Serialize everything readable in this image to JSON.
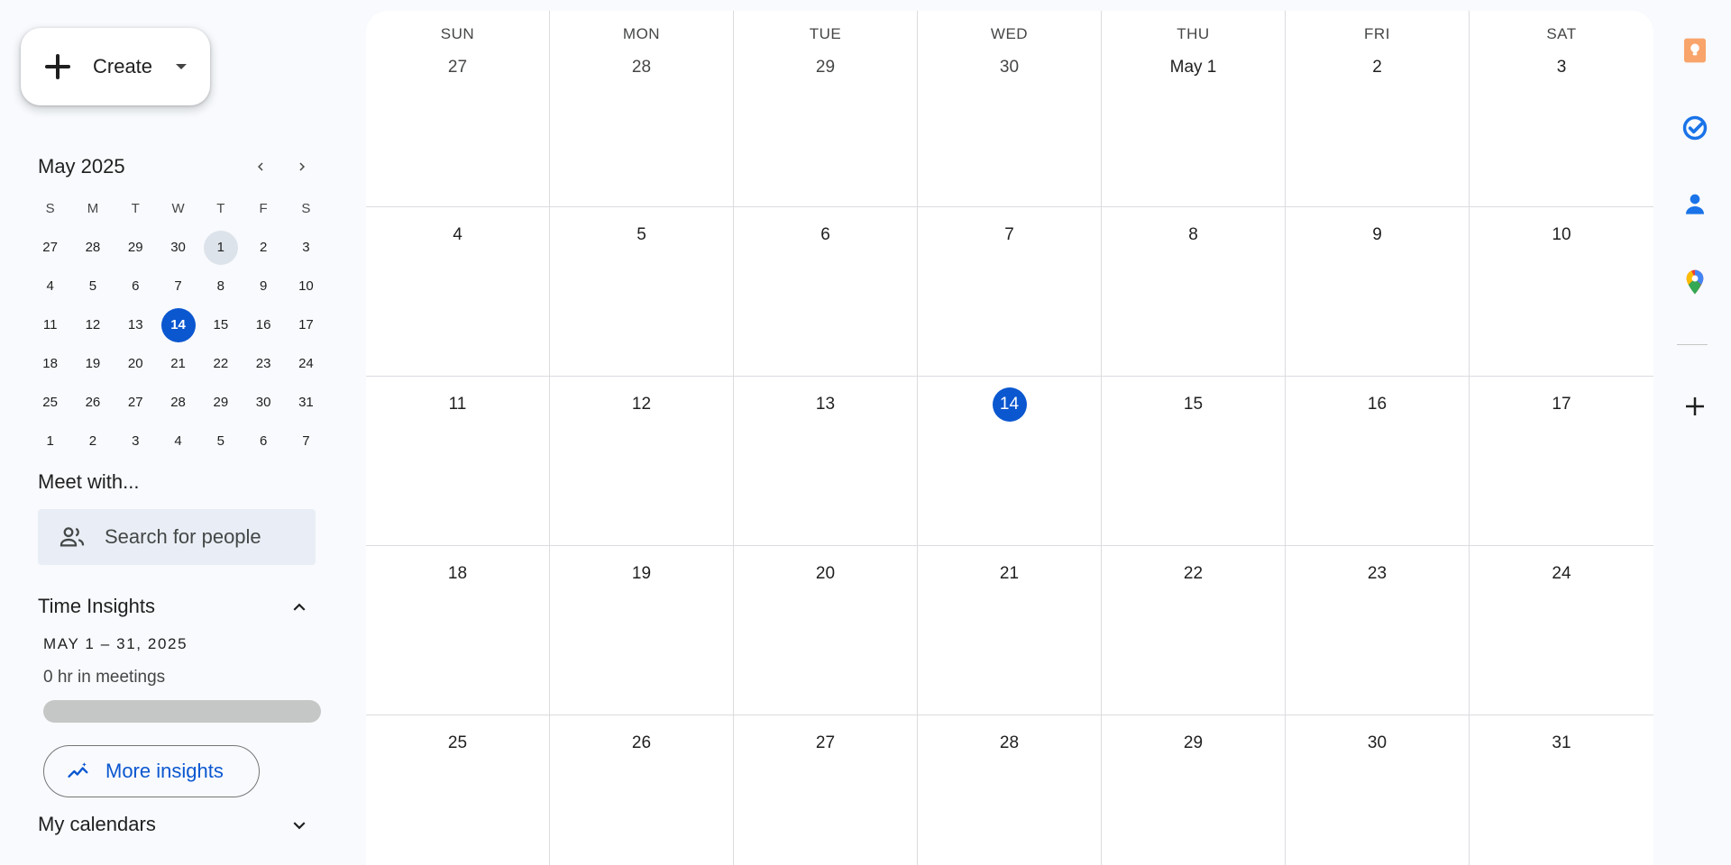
{
  "sidebar": {
    "create_label": "Create",
    "mini_calendar": {
      "title": "May 2025",
      "weekday_headers": [
        "S",
        "M",
        "T",
        "W",
        "T",
        "F",
        "S"
      ],
      "weeks": [
        [
          "27",
          "28",
          "29",
          "30",
          "1",
          "2",
          "3"
        ],
        [
          "4",
          "5",
          "6",
          "7",
          "8",
          "9",
          "10"
        ],
        [
          "11",
          "12",
          "13",
          "14",
          "15",
          "16",
          "17"
        ],
        [
          "18",
          "19",
          "20",
          "21",
          "22",
          "23",
          "24"
        ],
        [
          "25",
          "26",
          "27",
          "28",
          "29",
          "30",
          "31"
        ],
        [
          "1",
          "2",
          "3",
          "4",
          "5",
          "6",
          "7"
        ]
      ],
      "today": "14",
      "selected": "1"
    },
    "meet_with": {
      "title": "Meet with...",
      "search_placeholder": "Search for people"
    },
    "time_insights": {
      "title": "Time Insights",
      "range": "MAY 1 – 31, 2025",
      "hours": "0 hr in meetings",
      "meeting_fraction": 0,
      "more_label": "More insights"
    },
    "my_calendars": {
      "title": "My calendars"
    }
  },
  "month_view": {
    "weekdays": [
      "SUN",
      "MON",
      "TUE",
      "WED",
      "THU",
      "FRI",
      "SAT"
    ],
    "weeks": [
      [
        "27",
        "28",
        "29",
        "30",
        "May 1",
        "2",
        "3"
      ],
      [
        "4",
        "5",
        "6",
        "7",
        "8",
        "9",
        "10"
      ],
      [
        "11",
        "12",
        "13",
        "14",
        "15",
        "16",
        "17"
      ],
      [
        "18",
        "19",
        "20",
        "21",
        "22",
        "23",
        "24"
      ],
      [
        "25",
        "26",
        "27",
        "28",
        "29",
        "30",
        "31"
      ]
    ],
    "today": "14"
  },
  "side_panel": {
    "icons": [
      "keep-icon",
      "tasks-icon",
      "contacts-icon",
      "maps-icon",
      "add-icon"
    ],
    "colors": {
      "keep": "#f9a46b",
      "tasks": "#1a73e8",
      "contacts": "#1a73e8",
      "accent": "#0b57d0"
    }
  }
}
